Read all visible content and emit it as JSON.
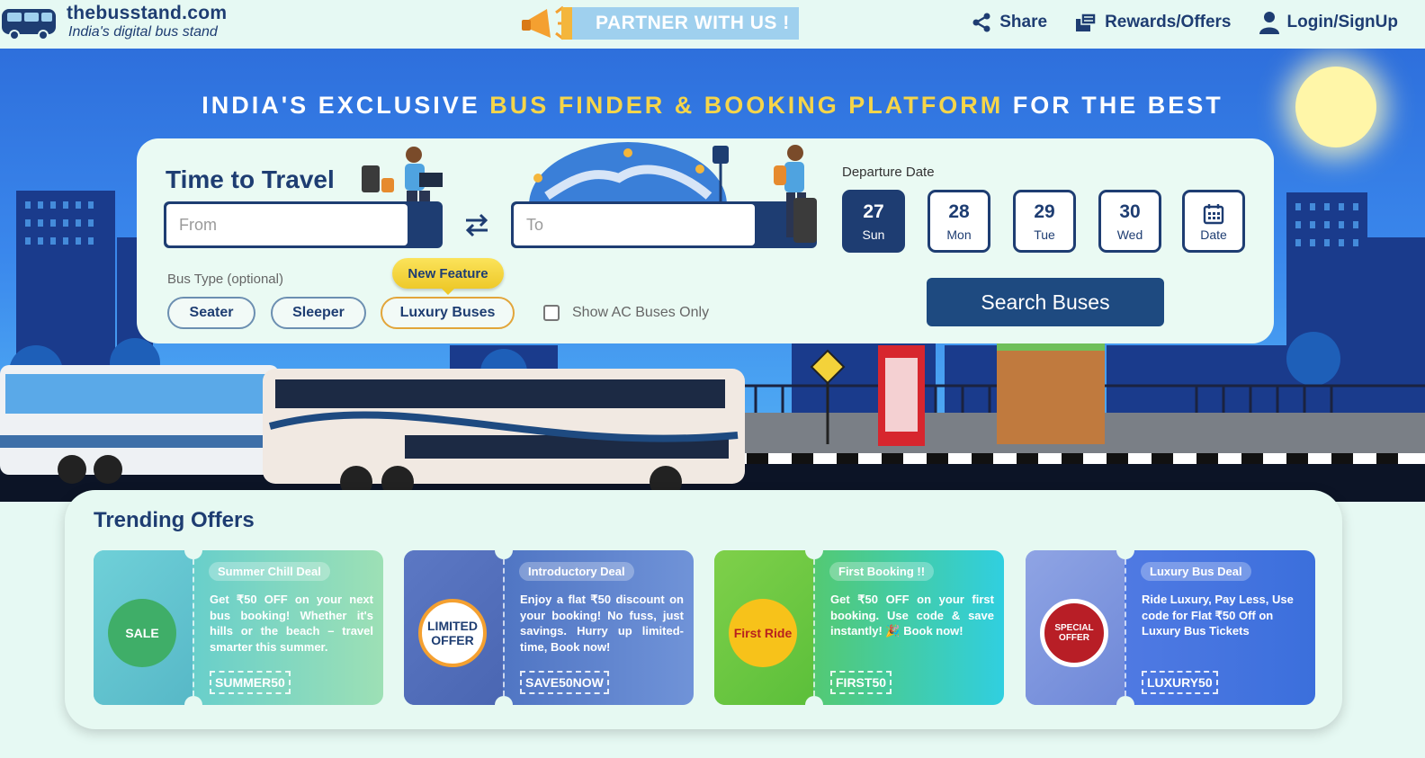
{
  "brand": {
    "name": "thebusstand.com",
    "tagline": "India's digital bus stand"
  },
  "header": {
    "partner_label": "PARTNER WITH US !",
    "nav": [
      {
        "label": "Share",
        "icon": "share-icon"
      },
      {
        "label": "Rewards/Offers",
        "icon": "rewards-icon"
      },
      {
        "label": "Login/SignUp",
        "icon": "user-icon"
      }
    ]
  },
  "hero": {
    "title_pre": "INDIA'S EXCLUSIVE ",
    "title_highlight": "BUS FINDER & BOOKING PLATFORM",
    "title_post": " FOR THE BEST",
    "accent_color": "#f5d54a"
  },
  "search": {
    "heading": "Time to Travel",
    "from_placeholder": "From",
    "to_placeholder": "To",
    "from_value": "",
    "to_value": "",
    "departure_label": "Departure Date",
    "dates": [
      {
        "num": "27",
        "day": "Sun",
        "selected": true
      },
      {
        "num": "28",
        "day": "Mon",
        "selected": false
      },
      {
        "num": "29",
        "day": "Tue",
        "selected": false
      },
      {
        "num": "30",
        "day": "Wed",
        "selected": false
      }
    ],
    "date_picker_label": "Date",
    "bus_type_label": "Bus Type (optional)",
    "bus_types": [
      "Seater",
      "Sleeper",
      "Luxury Buses"
    ],
    "new_feature_label": "New Feature",
    "ac_only_label": "Show AC Buses Only",
    "ac_only_checked": false,
    "search_button": "Search Buses"
  },
  "offers": {
    "title": "Trending Offers",
    "items": [
      {
        "tag": "Summer Chill Deal",
        "description": "Get ₹50 OFF on your next bus booking! Whether it's hills or the beach – travel smarter this summer.",
        "code": "SUMMER50",
        "badge_text": "SALE",
        "gradient": [
          "#4dc6d6",
          "#9de0b5"
        ]
      },
      {
        "tag": "Introductory Deal",
        "description": "Enjoy a flat ₹50 discount on your booking! No fuss, just savings. Hurry up limited-time, Book now!",
        "code": "SAVE50NOW",
        "badge_text": "LIMITED OFFER",
        "gradient": [
          "#3f66b9",
          "#7093d8"
        ]
      },
      {
        "tag": "First Booking !!",
        "description": "Get ₹50 OFF on your first booking. Use code & save instantly! 🎉 Book now!",
        "code": "FIRST50",
        "badge_text": "First Ride",
        "gradient": [
          "#66c63a",
          "#30cfe0"
        ]
      },
      {
        "tag": "Luxury Bus Deal",
        "description": "Ride Luxury, Pay Less, Use code for Flat ₹50 Off on Luxury Bus Tickets",
        "code": "LUXURY50",
        "badge_text": "SPECIAL OFFER",
        "gradient": [
          "#5a7fe6",
          "#3b6fdc"
        ]
      }
    ]
  }
}
